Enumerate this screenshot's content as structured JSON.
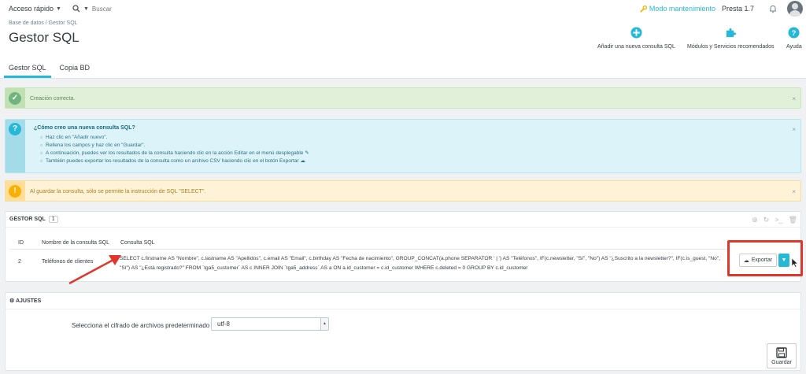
{
  "topbar": {
    "quick_access": "Acceso rápido",
    "search_placeholder": "Buscar",
    "maintenance": "Modo mantenimiento",
    "shop_name": "Presta 1.7"
  },
  "header": {
    "breadcrumb": "Base de datos  /  Gestor SQL",
    "title": "Gestor SQL",
    "toolbar": {
      "add": "Añadir una nueva consulta SQL",
      "modules": "Módulos y Servicios recomendados",
      "help": "Ayuda"
    },
    "tabs": [
      "Gestor SQL",
      "Copia BD"
    ],
    "active_tab": "Gestor SQL"
  },
  "alerts": {
    "success": "Creación correcta.",
    "info": {
      "title": "¿Cómo creo una nueva consulta SQL?",
      "items": [
        "Haz clic en \"Añadir nuevo\".",
        "Rellena los campos y haz clic en \"Guardar\".",
        "A continuación, puedes ver los resultados de la consulta haciendo clic en la acción Editar en el menú desplegable",
        "También puedes exportar los resultados de la consulta como un archivo CSV haciendo clic en el botón Exportar"
      ]
    },
    "warning": "Al guardar la consulta, sólo se permite la instrucción de SQL \"SELECT\"."
  },
  "sql_panel": {
    "title": "GESTOR SQL",
    "count": "1",
    "columns": [
      "ID",
      "Nombre de la consulta SQL",
      "Consulta SQL"
    ],
    "rows": [
      {
        "id": "2",
        "name": "Teléfonos de clientes",
        "query": "SELECT c.firstname AS \"Nombre\", c.lastname AS \"Apellidos\", c.email AS \"Email\", c.birthday AS \"Fecha de nacimiento\", GROUP_CONCAT(a.phone SEPARATOR ' | ') AS \"Teléfonos\", IF(c.newsletter, \"Sí\", \"No\") AS \"¿Suscrito a la newsletter?\", IF(c.is_guest, \"No\", \"Sí\") AS \"¿Está registrado?\" FROM `tga5_customer` AS c INNER JOIN `tga5_address` AS a ON a.id_customer = c.id_customer WHERE c.deleted = 0 GROUP BY c.id_customer"
      }
    ],
    "export_label": "Exportar"
  },
  "settings_panel": {
    "title": "AJUSTES",
    "encoding_label": "Selecciona el cifrado de archivos predeterminado",
    "encoding_value": "utf-8",
    "save_label": "Guardar"
  }
}
